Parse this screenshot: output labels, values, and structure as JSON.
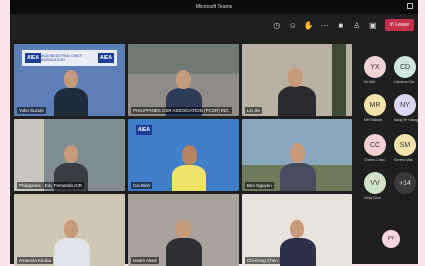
{
  "window": {
    "title": "Microsoft Teams"
  },
  "toolbar": {
    "leave_label": "Leave"
  },
  "tiles": [
    {
      "name": "Yoko Suzuki",
      "banner_logo": "AIEA",
      "banner_text": "ASIA INDUSTRIAL CHIEF ASSOCIATION"
    },
    {
      "name": "PHILIPPINES CSR ASSOCIATION (PCSR) INC."
    },
    {
      "name": "Lin Jie"
    },
    {
      "name": "Philippines - Edy Fernando ICR"
    },
    {
      "name": "Cai Binh",
      "banner_logo": "AIEA"
    },
    {
      "name": "Ben Nguyen"
    },
    {
      "name": "Ameenia Kiruba"
    },
    {
      "name": "Issam Abed"
    },
    {
      "name": "Chi-Keng Chen"
    }
  ],
  "participants": [
    {
      "initials": "YX",
      "name": "Xu Wei",
      "color": "#efd3d3"
    },
    {
      "initials": "CD",
      "name": "Cameron Da",
      "color": "#cfe7de"
    },
    {
      "initials": "MR",
      "name": "MR Rakesh",
      "color": "#f3e2a9"
    },
    {
      "initials": "NY",
      "name": "Nang Ye Hlaing",
      "color": "#dad7f0"
    },
    {
      "initials": "CC",
      "name": "Cheem Chan",
      "color": "#f3cfd2"
    },
    {
      "initials": "SM",
      "name": "Serene Mak",
      "color": "#f3e2a9"
    },
    {
      "initials": "VV",
      "name": "Vicky Voon",
      "color": "#d1e3c6"
    },
    {
      "initials": "+14",
      "name": "",
      "color": "#3a3a3a"
    },
    {
      "initials": "PY",
      "name": "",
      "color": "#f3d6dd"
    }
  ]
}
